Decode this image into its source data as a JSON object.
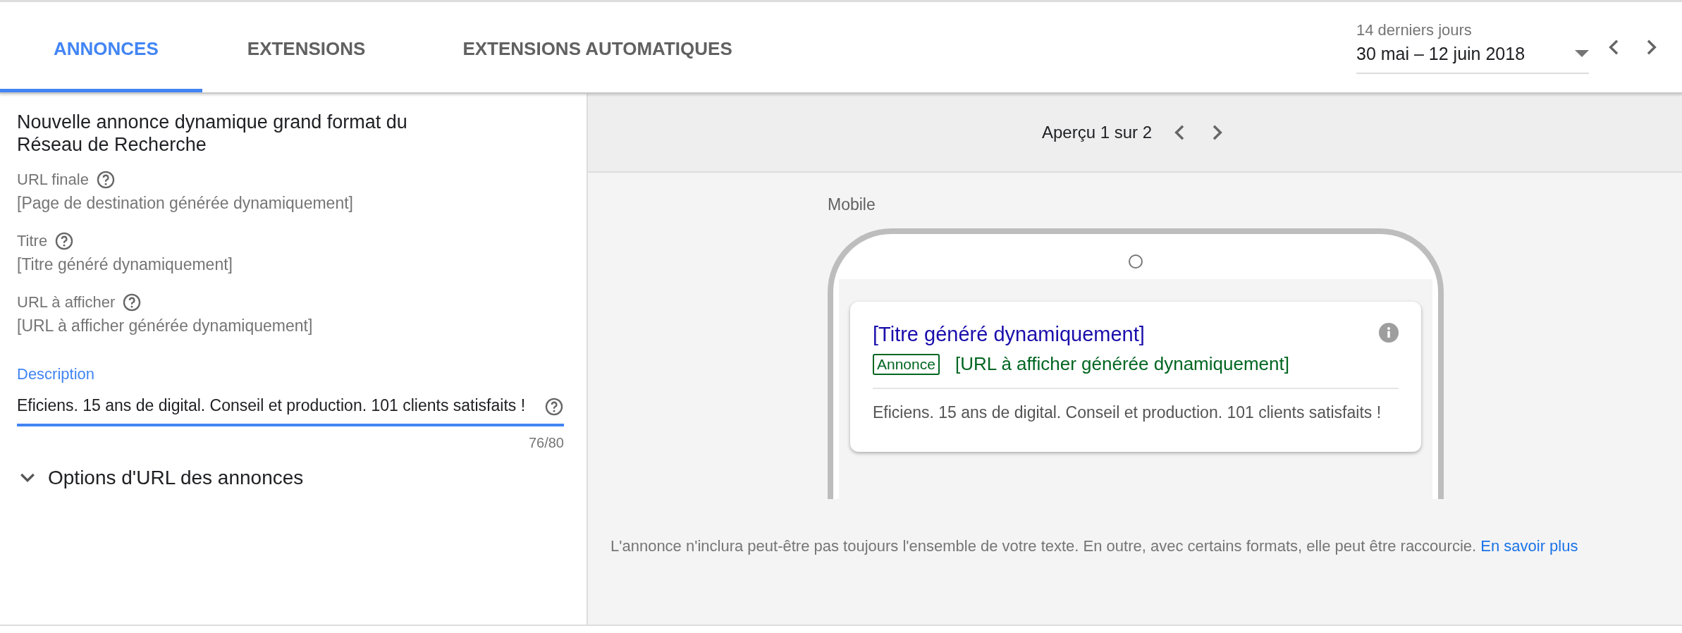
{
  "tabs": [
    {
      "label": "ANNONCES",
      "selected": true
    },
    {
      "label": "EXTENSIONS",
      "selected": false
    },
    {
      "label": "EXTENSIONS AUTOMATIQUES",
      "selected": false
    }
  ],
  "date_range": {
    "label": "14 derniers jours",
    "value": "30 mai – 12 juin 2018"
  },
  "editor": {
    "title": "Nouvelle annonce dynamique grand format du Réseau de Recherche",
    "fields": [
      {
        "label": "URL finale",
        "value": "[Page de destination générée dynamiquement]"
      },
      {
        "label": "Titre",
        "value": "[Titre généré dynamiquement]"
      },
      {
        "label": "URL à afficher",
        "value": "[URL à afficher générée dynamiquement]"
      }
    ],
    "description": {
      "label": "Description",
      "value": "Eficiens. 15 ans de digital. Conseil et production. 101 clients satisfaits !",
      "counter": "76/80",
      "focused": true
    },
    "url_options": {
      "label": "Options d'URL des annonces",
      "expanded": false
    }
  },
  "preview": {
    "pager": "Aperçu 1 sur 2",
    "device": "Mobile",
    "ad": {
      "headline": "[Titre généré dynamiquement]",
      "badge": "Annonce",
      "display_url": "[URL à afficher générée dynamiquement]",
      "description": "Eficiens. 15 ans de digital. Conseil et production. 101 clients satisfaits !"
    },
    "note": {
      "text": "L'annonce n'inclura peut-être pas toujours l'ensemble de votre texte. En outre, avec certains formats, elle peut être raccourcie.",
      "link": "En savoir plus"
    }
  }
}
